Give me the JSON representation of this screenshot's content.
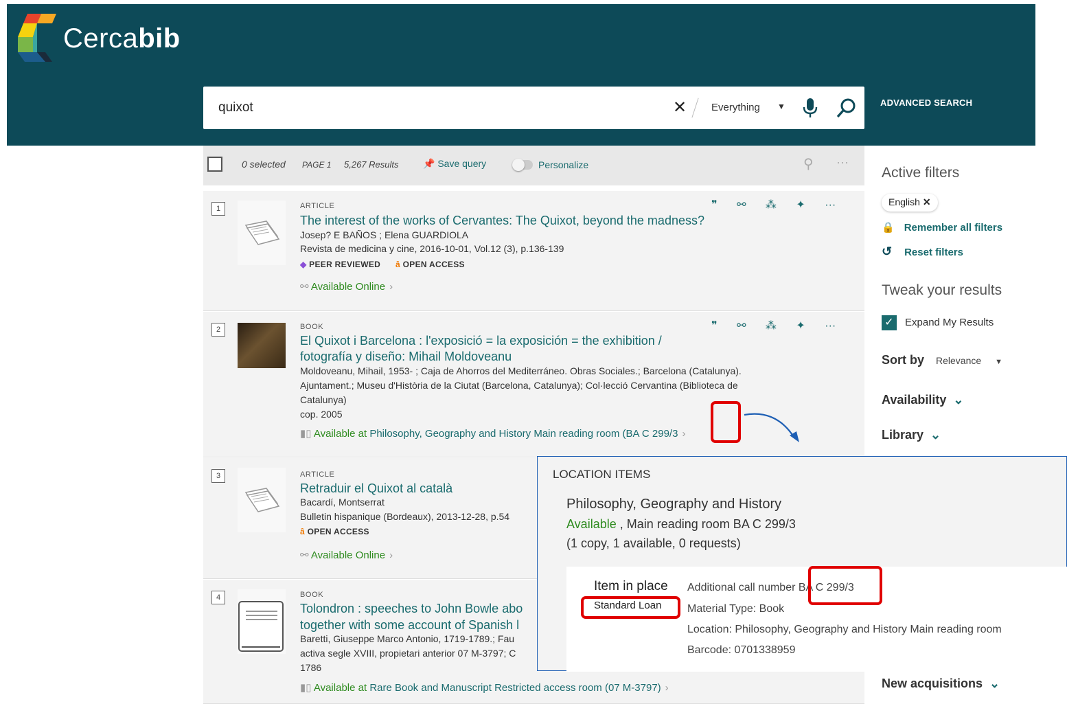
{
  "brand": {
    "name_light": "Cerca",
    "name_bold": "bib"
  },
  "search": {
    "query": "quixot",
    "scope": "Everything",
    "advanced_label": "ADVANCED SEARCH"
  },
  "toolbar": {
    "selected": "0 selected",
    "page": "PAGE 1",
    "results": "5,267 Results",
    "save_query": "Save query",
    "personalize": "Personalize"
  },
  "results": [
    {
      "num": "1",
      "type": "ARTICLE",
      "title": "The interest of the works of Cervantes: The Quixot, beyond the madness?",
      "authors": "Josep? E BAÑOS ; Elena GUARDIOLA",
      "source": "Revista de medicina y cine, 2016-10-01, Vol.12 (3), p.136-139",
      "badge_peer": "PEER REVIEWED",
      "badge_open": "OPEN ACCESS",
      "availability": "Available Online"
    },
    {
      "num": "2",
      "type": "BOOK",
      "title_line1": "El Quixot i Barcelona : l'exposició = la exposición = the exhibition /",
      "title_line2": "fotografía y diseño: Mihail Moldoveanu",
      "desc_line1": "Moldoveanu, Mihail, 1953- ; Caja de Ahorros del Mediterráneo. Obras Sociales.; Barcelona (Catalunya).",
      "desc_line2": "Ajuntament.; Museu d'Història de la Ciutat (Barcelona, Catalunya); Col·lecció Cervantina (Biblioteca de",
      "desc_line3": "Catalunya)",
      "date": "cop. 2005",
      "avail_prefix": "Available at",
      "avail_location": "Philosophy, Geography and History  Main reading room (BA C 299/3"
    },
    {
      "num": "3",
      "type": "ARTICLE",
      "title": "Retraduir el Quixot al català",
      "authors": "Bacardí, Montserrat",
      "source": "Bulletin hispanique (Bordeaux), 2013-12-28, p.54",
      "badge_open": "OPEN ACCESS",
      "availability": "Available Online"
    },
    {
      "num": "4",
      "type": "BOOK",
      "title_line1": "Tolondron : speeches to John Bowle abo",
      "title_line2": "together with some account of Spanish l",
      "desc_line1": "Baretti, Giuseppe Marco Antonio, 1719-1789.; Fau",
      "desc_line2": "activa segle XVIII, propietari anterior 07 M-3797; C",
      "date": "1786",
      "avail_prefix": "Available at",
      "avail_location": "Rare Book and Manuscript  Restricted access room (07 M-3797)"
    }
  ],
  "sidebar": {
    "active_filters": "Active filters",
    "chip": "English",
    "remember": "Remember all filters",
    "reset": "Reset filters",
    "tweak": "Tweak your results",
    "expand": "Expand My Results",
    "sort_label": "Sort by",
    "sort_value": "Relevance",
    "facets": [
      "Availability",
      "Library",
      "New acquisitions"
    ]
  },
  "callout": {
    "title": "LOCATION ITEMS",
    "library": "Philosophy, Geography and History",
    "status_available": "Available",
    "status_rest": " , Main reading room BA C 299/3",
    "copies": "(1 copy, 1 available, 0 requests)",
    "item_in_place": "Item in place",
    "standard_loan": "Standard Loan",
    "additional_call_label": "Additional call number",
    "additional_call_value": "BA C 299/3",
    "material_type": "Material Type: Book",
    "location": "Location: Philosophy, Geography and History Main reading room",
    "barcode": "Barcode: 0701338959"
  },
  "colors": {
    "header": "#0d4a58",
    "link": "#1a6b6e",
    "available": "#2e8b1f",
    "highlight": "#e00000"
  }
}
